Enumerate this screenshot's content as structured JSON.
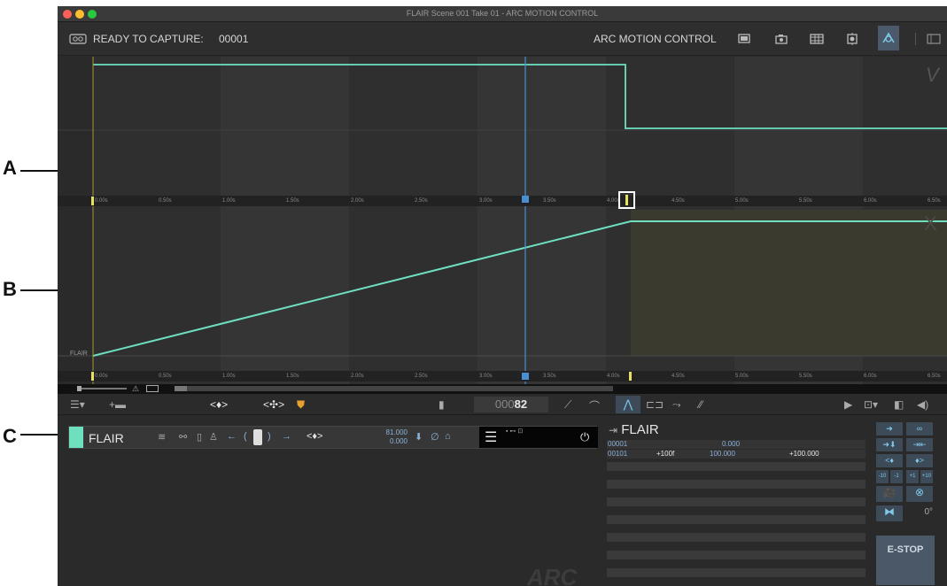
{
  "window": {
    "title": "FLAIR Scene 001 Take 01 - ARC MOTION CONTROL"
  },
  "topbar": {
    "status_label": "READY TO CAPTURE:",
    "frame_counter": "00001",
    "mode_label": "ARC MOTION CONTROL"
  },
  "callouts": {
    "a": "A",
    "b": "B",
    "c": "C"
  },
  "graph": {
    "top_marker": "V",
    "bottom_marker": "X",
    "track_label": "FLAIR",
    "ruler_labels": [
      "0.00s",
      "0.50s",
      "1.00s",
      "1.50s",
      "2.00s",
      "2.50s",
      "3.00s",
      "3.50s",
      "4.00s",
      "4.50s",
      "5.00s",
      "5.50s",
      "6.00s",
      "6.50s"
    ]
  },
  "toolbar2": {
    "frame_prefix": "000",
    "frame_current": "82"
  },
  "channel": {
    "name": "FLAIR",
    "value_top": "81.000",
    "value_bottom": "0.000",
    "color": "#6ee0c0"
  },
  "info": {
    "title": "FLAIR",
    "row1": {
      "frame": "00001",
      "value": "0.000"
    },
    "row2": {
      "frame": "00101",
      "offset": "+100f",
      "value": "100.000",
      "delta": "+100.000"
    }
  },
  "right_panel": {
    "rotation": "0°",
    "estop": "E-STOP"
  },
  "logo": "ARC",
  "colors": {
    "curve": "#6ee0c0",
    "playhead": "#4a8fd0",
    "keyframe": "#e8e060",
    "accent": "#7fc8ec"
  },
  "icons": [
    "camera-loop-icon",
    "monitor-icon",
    "camera-icon",
    "film-icon",
    "target-icon",
    "arc-icon",
    "panel-icon",
    "menu-icon",
    "keyframe-nav-icon",
    "lock-icon",
    "trash-icon",
    "play-icon",
    "speaker-icon",
    "power-icon"
  ]
}
